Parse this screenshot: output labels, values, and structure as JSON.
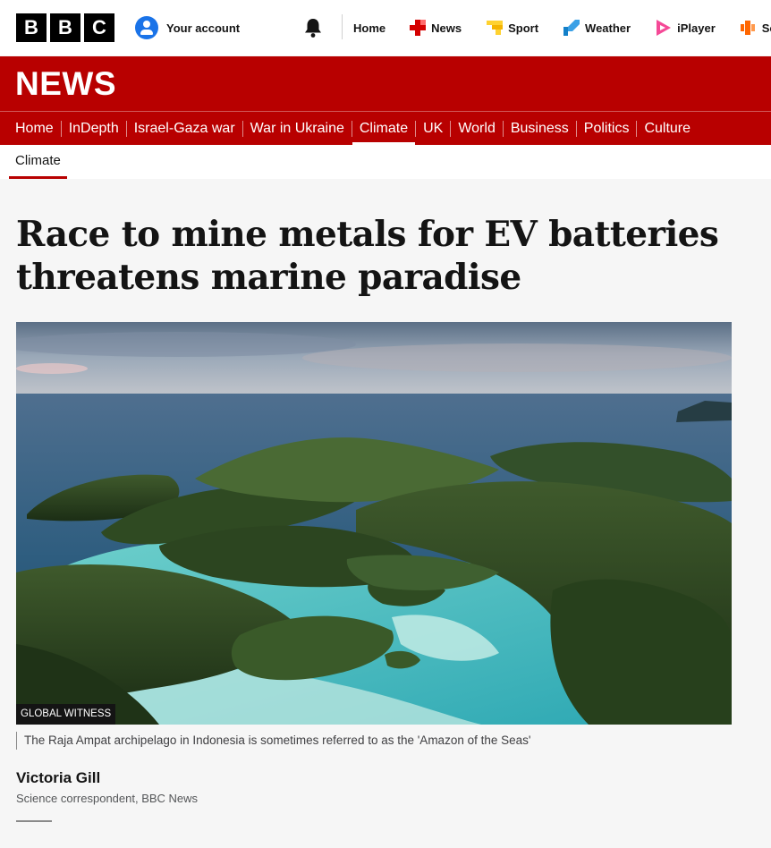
{
  "global_header": {
    "logo_letters": [
      "B",
      "B",
      "C"
    ],
    "account_label": "Your account",
    "nav": [
      {
        "label": "Home",
        "icon": "none"
      },
      {
        "label": "News",
        "icon": "news-icon",
        "color": "#d40000"
      },
      {
        "label": "Sport",
        "icon": "sport-icon",
        "color": "#ffd230"
      },
      {
        "label": "Weather",
        "icon": "weather-icon",
        "color": "#1380c9"
      },
      {
        "label": "iPlayer",
        "icon": "iplayer-icon",
        "color": "#f54997"
      },
      {
        "label": "Sou",
        "icon": "sounds-icon",
        "color": "#ff6600"
      }
    ]
  },
  "news_header": {
    "title": "NEWS",
    "brand_color": "#b80000",
    "nav": [
      {
        "label": "Home",
        "active": false
      },
      {
        "label": "InDepth",
        "active": false
      },
      {
        "label": "Israel-Gaza war",
        "active": false
      },
      {
        "label": "War in Ukraine",
        "active": false
      },
      {
        "label": "Climate",
        "active": true
      },
      {
        "label": "UK",
        "active": false
      },
      {
        "label": "World",
        "active": false
      },
      {
        "label": "Business",
        "active": false
      },
      {
        "label": "Politics",
        "active": false
      },
      {
        "label": "Culture",
        "active": false
      }
    ]
  },
  "subnav": {
    "active_label": "Climate"
  },
  "article": {
    "headline": "Race to mine metals for EV batteries threatens marine paradise",
    "image_credit": "GLOBAL WITNESS",
    "image_caption": "The Raja Ampat archipelago in Indonesia is sometimes referred to as the 'Amazon of the Seas'",
    "author_name": "Victoria Gill",
    "author_role": "Science correspondent, BBC News"
  }
}
